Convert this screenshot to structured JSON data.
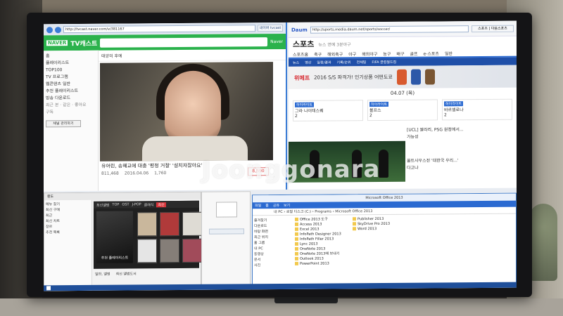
{
  "watermark": "Joonggonara",
  "left_browser": {
    "url": "http://tvcast.naver.com/v/381167",
    "tab": "네이버 tvcast",
    "brand": "NAVER",
    "title": "TV캐스트",
    "login": "Naver",
    "channel": "태양의 후예",
    "side_items": [
      "홈",
      "플레이리스트",
      "TOP100",
      "TV 프로그램",
      "웹콘텐츠 일반",
      "추천 플레이리스트",
      "방송 다운로드"
    ],
    "side_sub": [
      "최근 본 · 같은 · 좋아요",
      "구독"
    ],
    "side_button": "채널 관리하기",
    "caption": "유어린, 송혜교에 대충 '평정 거절' '설치자잖아요'",
    "views": "811,468",
    "date": "2016.04.06",
    "like_count": "1,760",
    "hearts": "8,590"
  },
  "right_browser": {
    "url": "http://sports.media.daum.net/sports/soccer/",
    "tab": "스포츠 | 다음스포츠",
    "brand": "Daum",
    "section_title": "스포츠",
    "section_sub": "뉴스 연예 3분야구",
    "nav": [
      "스포츠홈",
      "축구",
      "해외축구",
      "야구",
      "해외야구",
      "농구",
      "배구",
      "골프",
      "e-스포츠",
      "일반"
    ],
    "subnav": [
      "뉴스",
      "영상",
      "일정/결과",
      "기록/순위",
      "전체팀",
      "FIFA 클럽월드컵"
    ],
    "banner_brand": "위메프",
    "banner_text": "2016 S/S 파격가! 인기상품 어떤도쿄",
    "date": "04.07 (목)",
    "scores": [
      {
        "badge": "하이라이트",
        "line1": "그라 나이테스퀘",
        "score": "2"
      },
      {
        "badge": "하이라이트",
        "line1": "볼프스",
        "score": "2"
      },
      {
        "badge": "하이라이트",
        "line1": "바르셀로나",
        "score": "2"
      }
    ],
    "news": [
      "[UCL] 쌀라리, PSG 원정에서...",
      "가능성",
      "울트사우스전 '대한국 우리...'",
      "다고나"
    ]
  },
  "media_app": {
    "title": "윈도",
    "side_items": [
      "메뉴 찾기",
      "최신 구매",
      "최근",
      "최신 차트",
      "장르",
      "추천 목록"
    ],
    "tabs": [
      "최신앨범",
      "TOP",
      "OST",
      "J-POP",
      "클래식",
      "팝"
    ],
    "active_tab": "최신",
    "hero_label": "추천 플레이리스트",
    "footer": [
      "일반, 앨범",
      "최신 앨범도서"
    ]
  },
  "explorer": {
    "title": "Microsoft Office 2013",
    "tabs": [
      "파일",
      "홈",
      "공유",
      "보기"
    ],
    "path": "내 PC › 로컬 디스크 (C:) › Programs › Microsoft Office 2013",
    "side": [
      "즐겨찾기",
      "다운로드",
      "바탕 화면",
      "최근 위치",
      "홈 그룹",
      "내 PC",
      "동영상",
      "문서",
      "사진"
    ],
    "files_left": [
      "Office 2013 도구",
      "Access 2013",
      "Excel 2013",
      "InfoPath Designer 2013",
      "InfoPath Filler 2013",
      "Lync 2013",
      "OneNote 2013",
      "OneNote 2013에 보내기",
      "Outlook 2013",
      "PowerPoint 2013"
    ],
    "files_right": [
      "Publisher 2013",
      "SkyDrive Pro 2013",
      "Word 2013"
    ]
  }
}
